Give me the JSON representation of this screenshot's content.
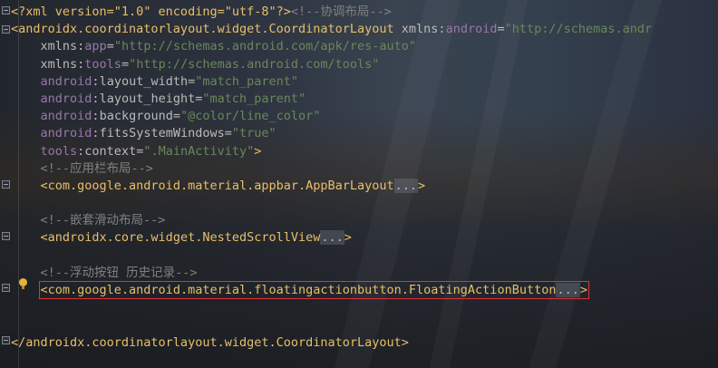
{
  "editor": {
    "l1": {
      "xml_decl": "<?xml version=\"1.0\" encoding=\"utf-8\"?>",
      "comment": "<!--协调布局-->"
    },
    "l2": {
      "open": "<androidx.coordinatorlayout.widget.CoordinatorLayout",
      "attr_ns": "xmlns",
      "attr": "android",
      "eq": "=",
      "val": "\"http://schemas.andr"
    },
    "l3": {
      "ns": "xmlns",
      "attr": "app",
      "val": "\"http://schemas.android.com/apk/res-auto\""
    },
    "l4": {
      "ns": "xmlns",
      "attr": "tools",
      "val": "\"http://schemas.android.com/tools\""
    },
    "l5": {
      "ns": "android",
      "attr": "layout_width",
      "val": "\"match_parent\""
    },
    "l6": {
      "ns": "android",
      "attr": "layout_height",
      "val": "\"match_parent\""
    },
    "l7": {
      "ns": "android",
      "attr": "background",
      "val": "\"@color/line_color\""
    },
    "l8": {
      "ns": "android",
      "attr": "fitsSystemWindows",
      "val": "\"true\""
    },
    "l9": {
      "ns": "tools",
      "attr": "context",
      "val": "\".MainActivity\"",
      "close": ">"
    },
    "l10": {
      "comment": "<!--应用栏布局-->"
    },
    "l11": {
      "tag": "<com.google.android.material.appbar.AppBarLayout",
      "dots": "...",
      "close": ">"
    },
    "l13": {
      "comment": "<!--嵌套滑动布局-->"
    },
    "l14": {
      "tag": "<androidx.core.widget.NestedScrollView",
      "dots": "...",
      "close": ">"
    },
    "l16": {
      "comment": "<!--浮动按钮 历史记录-->"
    },
    "l17": {
      "tag": "<com.google.android.material.floatingactionbutton.",
      "tag2": "FloatingActionButton",
      "dots": "...",
      "close": ">"
    },
    "l20": {
      "close_tag": "</androidx.coordinatorlayout.widget.CoordinatorLayout>"
    }
  }
}
